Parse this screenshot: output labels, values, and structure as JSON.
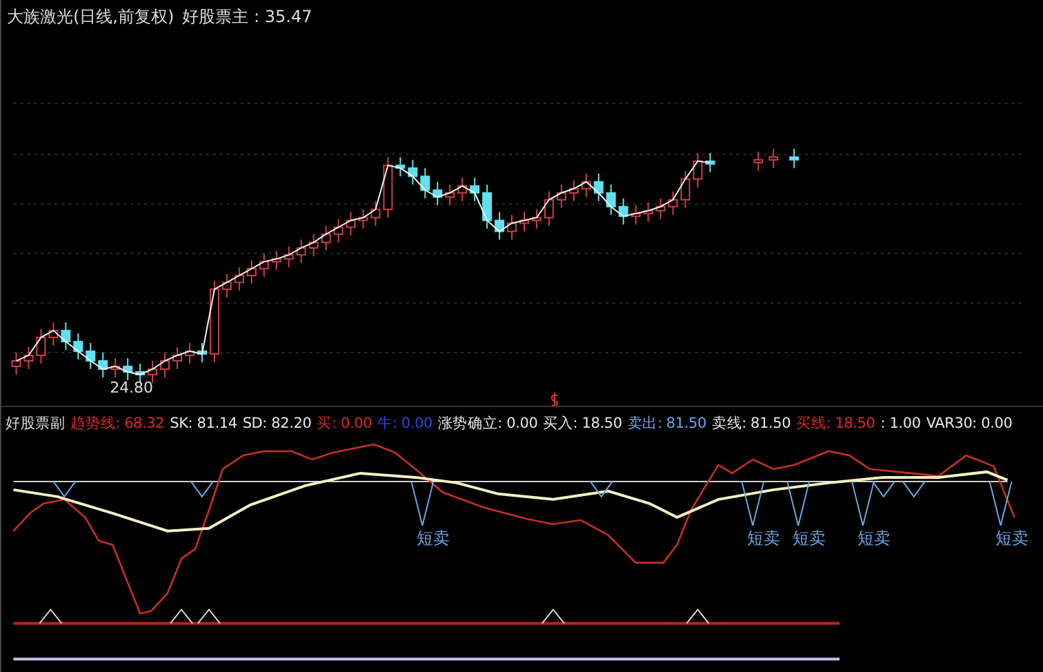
{
  "main_panel": {
    "title": "大族激光(日线,前复权)",
    "indicator": "好股票主 : 35.47",
    "low_label": "24.80"
  },
  "sub_panel": {
    "name": "好股票副",
    "indicators": [
      {
        "text": "趋势线: 68.32",
        "color": "#e02828"
      },
      {
        "text": "SK: 81.14",
        "color": "#e8e8e8"
      },
      {
        "text": "SD: 82.20",
        "color": "#e8e8e8"
      },
      {
        "text": "买: 0.00",
        "color": "#e02828"
      },
      {
        "text": "牛: 0.00",
        "color": "#2848e8"
      },
      {
        "text": "涨势确立: 0.00",
        "color": "#e8e8e8"
      },
      {
        "text": "买入: 18.50",
        "color": "#e8e8e8"
      },
      {
        "text": "卖出: 81.50",
        "color": "#6aa8e8"
      },
      {
        "text": "卖线: 81.50",
        "color": "#e8e8e8"
      },
      {
        "text": "买线: 18.50",
        "color": "#e02828"
      },
      {
        "text": ": 1.00",
        "color": "#e8e8e8"
      },
      {
        "text": "VAR30: 0.00",
        "color": "#e8e8e8"
      }
    ],
    "signals": [
      {
        "label": "短卖"
      },
      {
        "label": "短卖"
      },
      {
        "label": "短卖"
      },
      {
        "label": "短卖"
      },
      {
        "label": "短卖"
      }
    ]
  }
}
